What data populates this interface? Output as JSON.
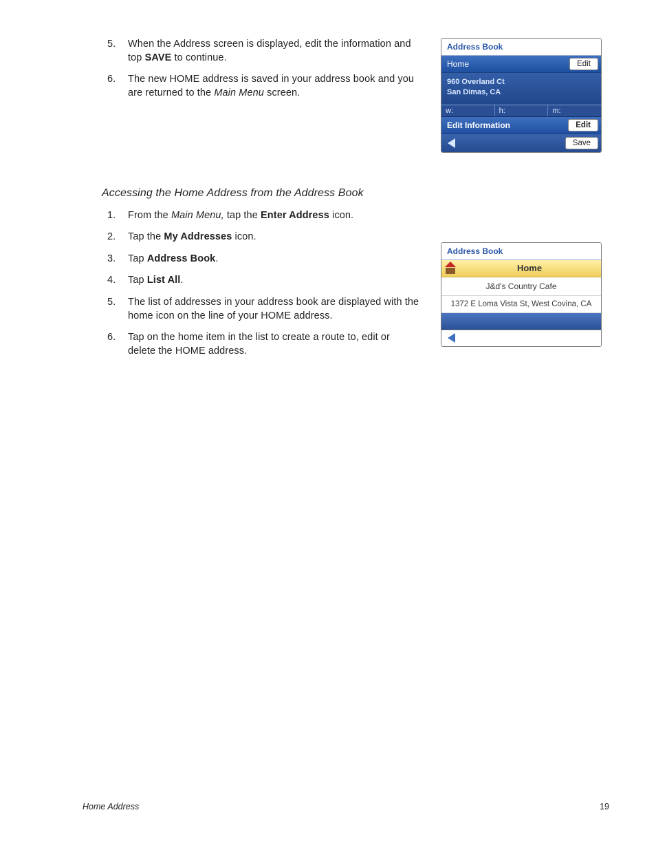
{
  "section1": {
    "items": [
      {
        "num": "5.",
        "pre": "When the Address screen is displayed, edit the information and top ",
        "bold": "SAVE",
        "post": " to continue."
      },
      {
        "num": "6.",
        "pre": "The new HOME address is saved in your address book and you are returned to the ",
        "italic": "Main Menu",
        "post": " screen."
      }
    ]
  },
  "heading": "Accessing the Home Address from the Address Book",
  "section2": {
    "items": [
      {
        "num": "1.",
        "pre": "From the ",
        "italic": "Main Menu,",
        "mid": " tap the ",
        "bold": "Enter Address",
        "post": " icon."
      },
      {
        "num": "2.",
        "pre": "Tap the ",
        "bold": "My Addresses",
        "post": " icon."
      },
      {
        "num": "3.",
        "pre": "Tap ",
        "bold": "Address Book",
        "post": "."
      },
      {
        "num": "4.",
        "pre": "Tap ",
        "bold": "List All",
        "post": "."
      },
      {
        "num": "5.",
        "plain": "The list of addresses in your address book are displayed with the home icon on the line of your HOME address."
      },
      {
        "num": "6.",
        "plain": "Tap on the home item in the list to create a route to, edit or delete the HOME address."
      }
    ]
  },
  "fig1": {
    "title": "Address Book",
    "home": "Home",
    "edit": "Edit",
    "addr_line1": "960 Overland Ct",
    "addr_line2": "San Dimas, CA",
    "tab_w": "w:",
    "tab_h": "h:",
    "tab_m": "m:",
    "editinfo": "Edit Information",
    "save": "Save"
  },
  "fig2": {
    "title": "Address Book",
    "home_label": "Home",
    "item1": "J&d's Country Cafe",
    "item2": "1372 E Loma Vista St, West Covina, CA"
  },
  "footer": {
    "left": "Home Address",
    "right": "19"
  }
}
